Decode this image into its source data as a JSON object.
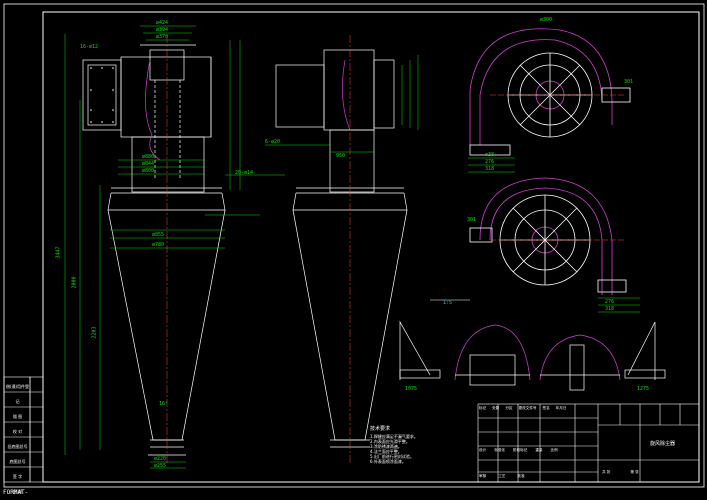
{
  "format_label": "FORMAT-",
  "dims": {
    "top_w1": "ø424",
    "top_w2": "ø394",
    "top_w3": "ø370",
    "flange": "16-ø12",
    "mid1": "ø880",
    "mid2": "ø844",
    "mid3": "ø800",
    "bolts": "20-ø14",
    "d1": "ø855",
    "d2": "ø780",
    "h_total": "3447",
    "h_cone": "2000",
    "h_body": "2203",
    "angle": "16°",
    "outlet1": "ø220",
    "outlet2": "ø255",
    "side_bolts": "6-ø20",
    "side_w": "950",
    "r1": "301",
    "r2": "301",
    "w1": "ø38",
    "w2": "276",
    "w3": "318",
    "w4": "276",
    "w5": "318",
    "d_lower": "1075",
    "d_lower2": "1275",
    "wheel": "ø300",
    "view_label": "1:5"
  },
  "notes": {
    "title": "技术要求",
    "lines": [
      "1.焊缝应满足不漏气要求。",
      "2.内表面应光滑平整。",
      "3.涂防锈漆两遍。",
      "4.法兰面应平整。",
      "5.出厂前进行密封试验。",
      "6.外表面喷涂面漆。"
    ]
  },
  "left_table": {
    "rows": [
      "借(通)用件登记",
      "描 图",
      "校 对",
      "旧底图总号",
      "底图总号",
      "签 字",
      "日 期"
    ]
  },
  "title_block": {
    "h1": [
      "标记",
      "处数",
      "分区",
      "更改文件号",
      "签名",
      "年月日"
    ],
    "h2": [
      "设计",
      "标准化",
      "阶段标记",
      "重量",
      "比例"
    ],
    "h3": [
      "审核",
      "工艺",
      "批准"
    ],
    "h4": [
      "共 张",
      "第 张"
    ],
    "name": "旋风除尘器"
  }
}
